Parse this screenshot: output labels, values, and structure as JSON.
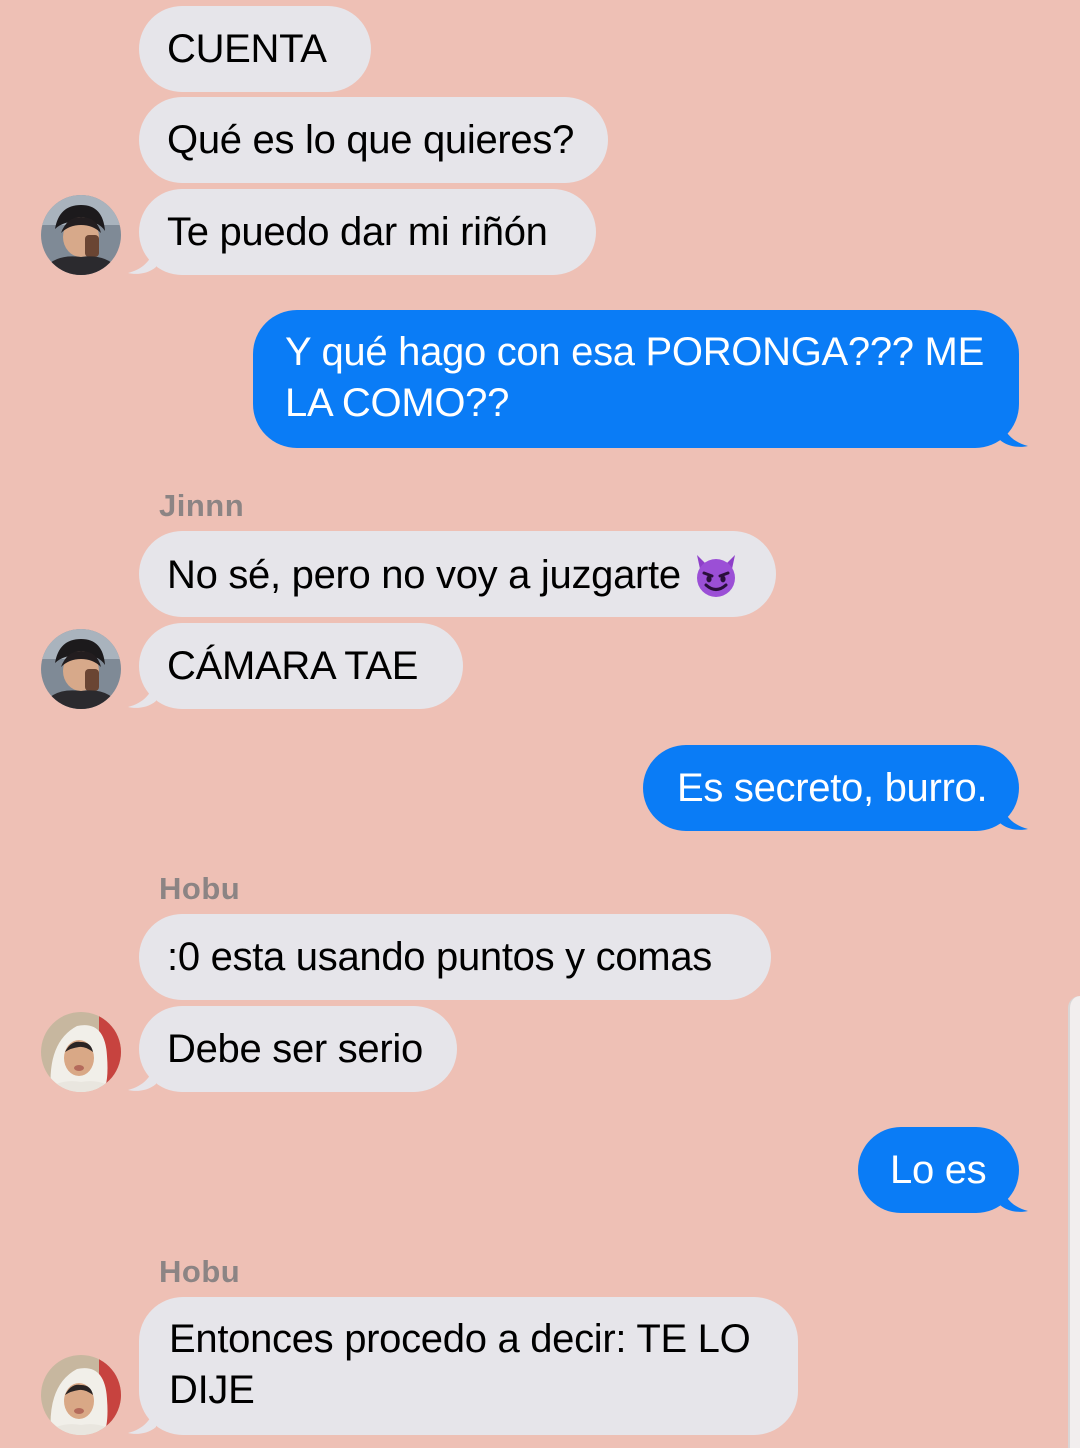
{
  "messages": [
    {
      "id": "m1",
      "direction": "incoming",
      "text": "CUENTA"
    },
    {
      "id": "m2",
      "direction": "incoming",
      "text": "Qué es lo que quieres?"
    },
    {
      "id": "m3",
      "direction": "incoming",
      "text": "Te puedo dar mi riñón",
      "avatar": "avatar-jinnn"
    },
    {
      "id": "m4",
      "direction": "outgoing",
      "text": "Y qué hago con esa PORONGA??? ME LA COMO??"
    },
    {
      "id": "m5",
      "direction": "incoming",
      "sender": "Jinnn",
      "text": "No sé, pero no voy a juzgarte",
      "emoji": "smiling-devil-emoji"
    },
    {
      "id": "m6",
      "direction": "incoming",
      "text": "CÁMARA TAE",
      "avatar": "avatar-jinnn"
    },
    {
      "id": "m7",
      "direction": "outgoing",
      "text": "Es secreto, burro."
    },
    {
      "id": "m8",
      "direction": "incoming",
      "sender": "Hobu",
      "text": ":0 esta usando puntos y comas"
    },
    {
      "id": "m9",
      "direction": "incoming",
      "text": "Debe ser serio",
      "avatar": "avatar-hobu"
    },
    {
      "id": "m10",
      "direction": "outgoing",
      "text": "Lo es"
    },
    {
      "id": "m11",
      "direction": "incoming",
      "sender": "Hobu",
      "text": "Entonces procedo a decir: TE LO DIJE",
      "avatar": "avatar-hobu"
    }
  ],
  "colors": {
    "background": "#eec0b5",
    "incoming_bubble": "#e6e5ea",
    "outgoing_bubble": "#0a7cf6",
    "sender_label": "#8c8484"
  }
}
